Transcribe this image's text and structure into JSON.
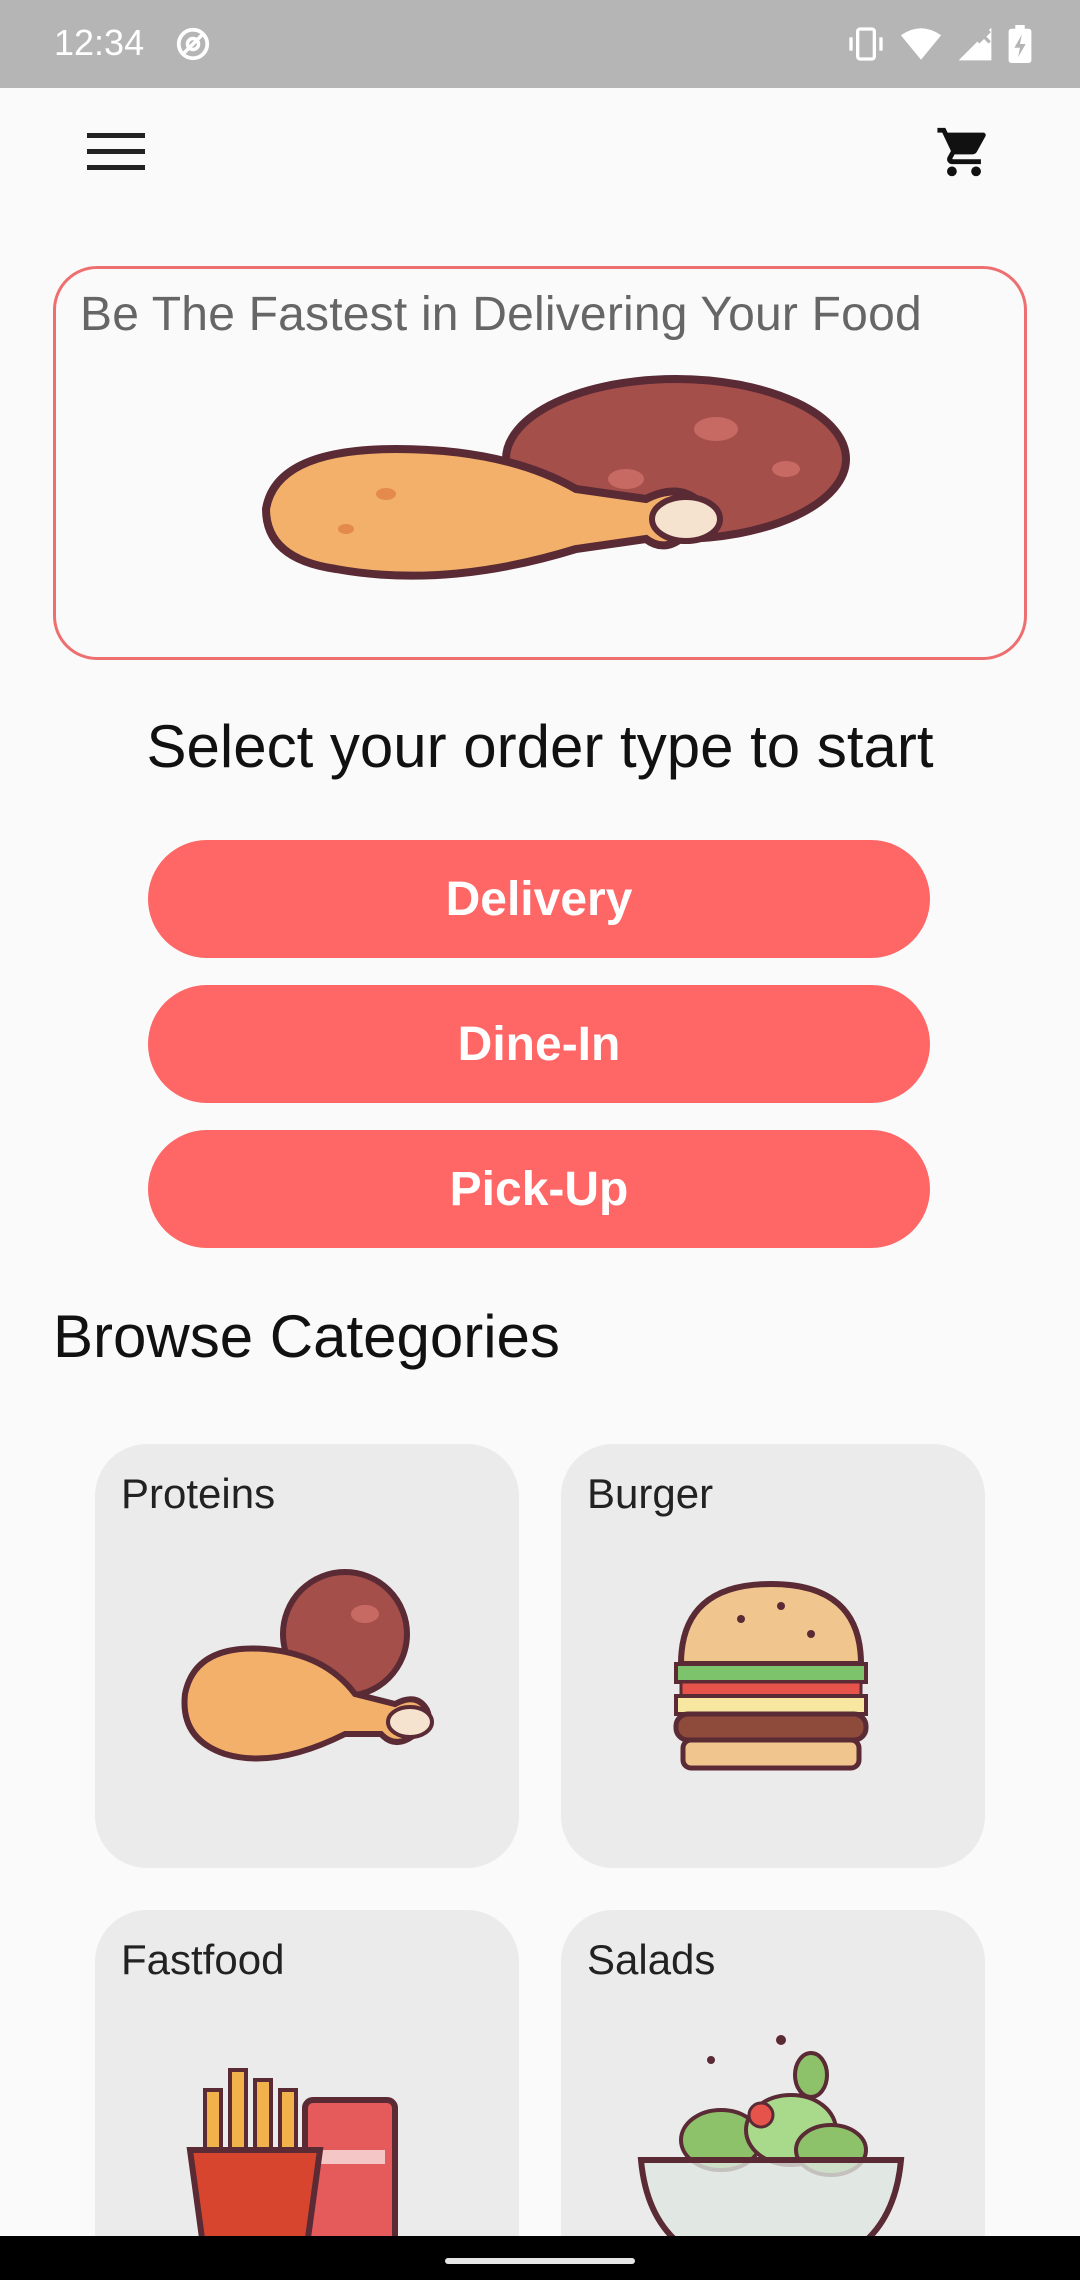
{
  "status_bar": {
    "time": "12:34"
  },
  "app_bar": {
    "menu_icon": "hamburger-menu-icon",
    "cart_icon": "shopping-cart-icon"
  },
  "banner": {
    "text": "Be The Fastest in Delivering Your Food",
    "image": "chicken-drumsticks-illustration"
  },
  "order": {
    "title": "Select your order type to start",
    "buttons": [
      "Delivery",
      "Dine-In",
      "Pick-Up"
    ]
  },
  "browse": {
    "title": "Browse Categories",
    "categories": [
      {
        "label": "Proteins",
        "icon": "chicken-leg-icon"
      },
      {
        "label": "Burger",
        "icon": "burger-icon"
      },
      {
        "label": "Fastfood",
        "icon": "fries-and-drink-icon"
      },
      {
        "label": "Salads",
        "icon": "salad-bowl-icon"
      }
    ]
  },
  "colors": {
    "accent": "#ff6666",
    "banner_border": "#ee6f6f",
    "card_bg": "#ebebeb",
    "status_bar": "#b5b5b5"
  }
}
